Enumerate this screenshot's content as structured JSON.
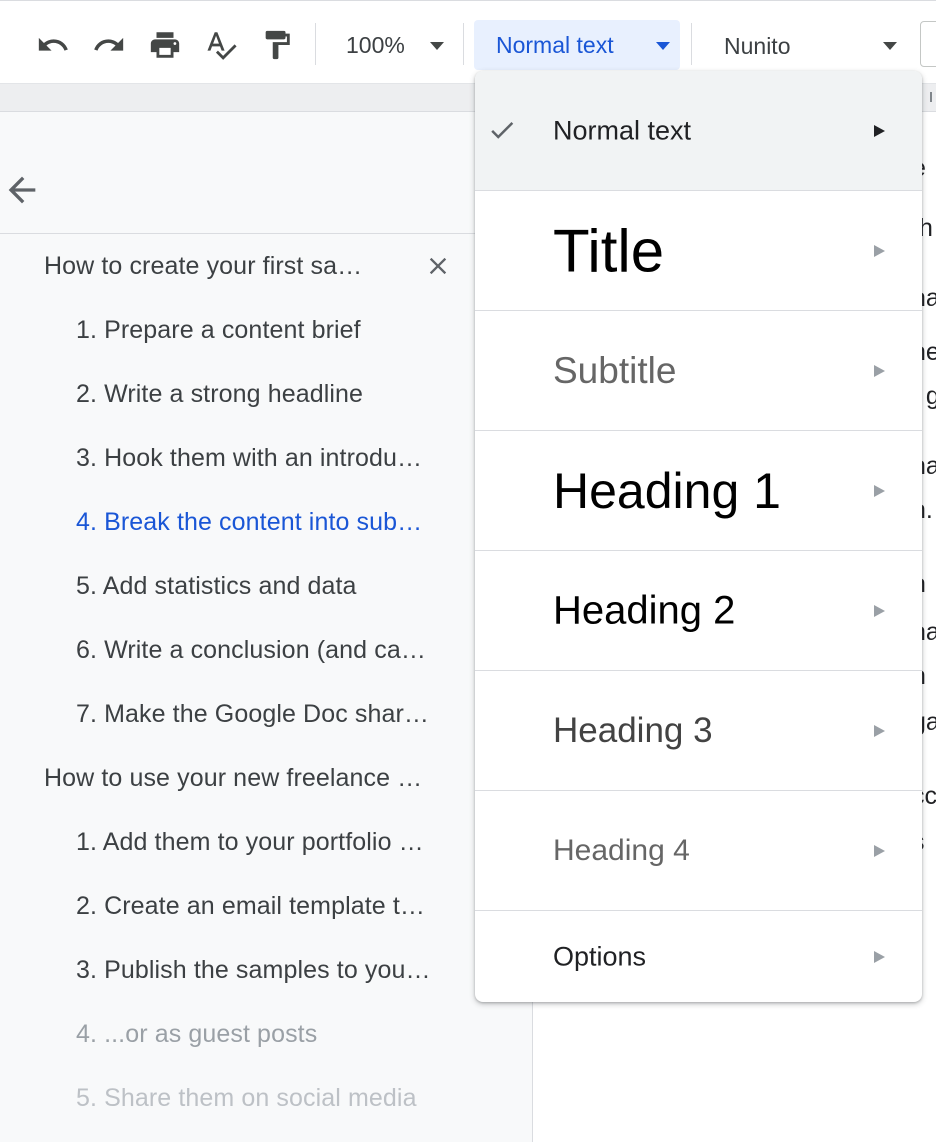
{
  "toolbar": {
    "icons": [
      "undo-icon",
      "redo-icon",
      "print-icon",
      "spellcheck-icon",
      "paint-format-icon"
    ],
    "zoom": "100%",
    "paragraph_style": "Normal text",
    "font": "Nunito"
  },
  "outline": {
    "items": [
      {
        "label": "How to create your first sa…",
        "level": 1
      },
      {
        "label": "1. Prepare a content brief",
        "level": 2
      },
      {
        "label": "2. Write a strong headline",
        "level": 2
      },
      {
        "label": "3. Hook them with an introdu…",
        "level": 2
      },
      {
        "label": "4. Break the content into sub…",
        "level": 2,
        "active": true
      },
      {
        "label": "5. Add statistics and data",
        "level": 2
      },
      {
        "label": "6. Write a conclusion (and ca…",
        "level": 2
      },
      {
        "label": "7. Make the Google Doc shar…",
        "level": 2
      },
      {
        "label": "How to use your new freelance …",
        "level": 1
      },
      {
        "label": "1. Add them to your portfolio …",
        "level": 2
      },
      {
        "label": "2. Create an email template t…",
        "level": 2
      },
      {
        "label": "3. Publish the samples to you…",
        "level": 2
      },
      {
        "label": "4. ...or as guest posts",
        "level": 2
      },
      {
        "label": "5. Share them on social media",
        "level": 2
      }
    ]
  },
  "style_menu": {
    "items": [
      {
        "label": "Normal text",
        "selected": true
      },
      {
        "label": "Title"
      },
      {
        "label": "Subtitle"
      },
      {
        "label": "Heading 1"
      },
      {
        "label": "Heading 2"
      },
      {
        "label": "Heading 3"
      },
      {
        "label": "Heading 4"
      },
      {
        "label": "Options"
      }
    ]
  },
  "document_peek": [
    "e",
    "th",
    "na",
    "ne",
    "t g",
    "na",
    "n.",
    "h",
    "na",
    "h",
    "ga",
    "cc",
    "s"
  ],
  "colors": {
    "accent": "#1a56d6",
    "selected_bg": "#e8f0fe",
    "sidebar_bg": "#f8f9fa"
  }
}
